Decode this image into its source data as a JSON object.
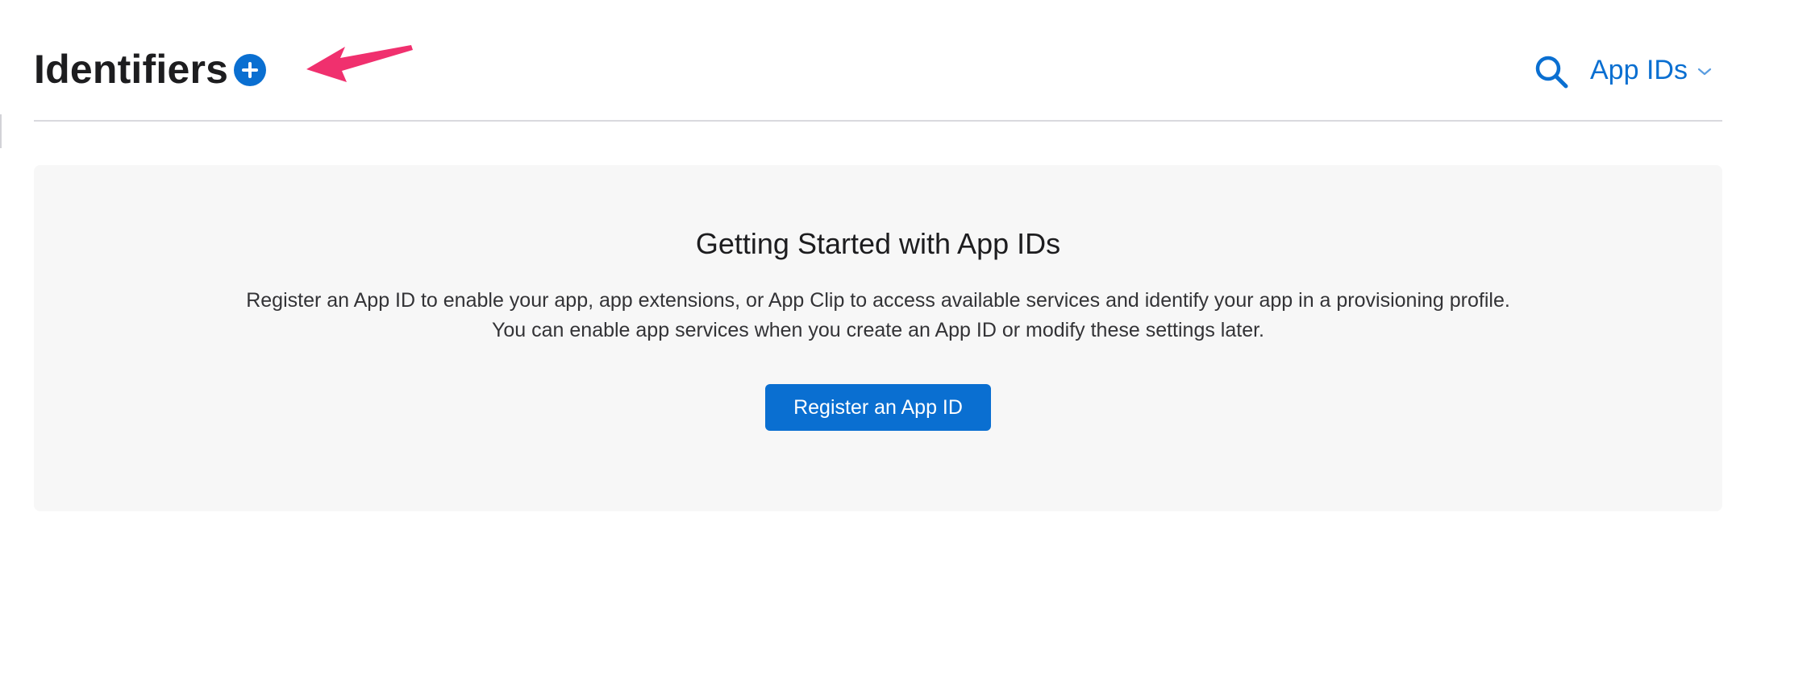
{
  "header": {
    "title": "Identifiers",
    "filter_selected": "App IDs"
  },
  "icons": {
    "add": "plus-circle-icon",
    "search": "search-icon",
    "filter_chevron": "chevron-down-icon",
    "annotation": "arrow-annotation"
  },
  "colors": {
    "accent": "#0a6fd1",
    "annotation": "#f0306e",
    "panel_background": "#f7f7f7"
  },
  "empty_state": {
    "title": "Getting Started with App IDs",
    "description_lines": [
      "Register an App ID to enable your app, app extensions, or App Clip to access available services and identify your app in a provisioning profile.",
      "You can enable app services when you create an App ID or modify these settings later."
    ],
    "button_label": "Register an App ID"
  }
}
